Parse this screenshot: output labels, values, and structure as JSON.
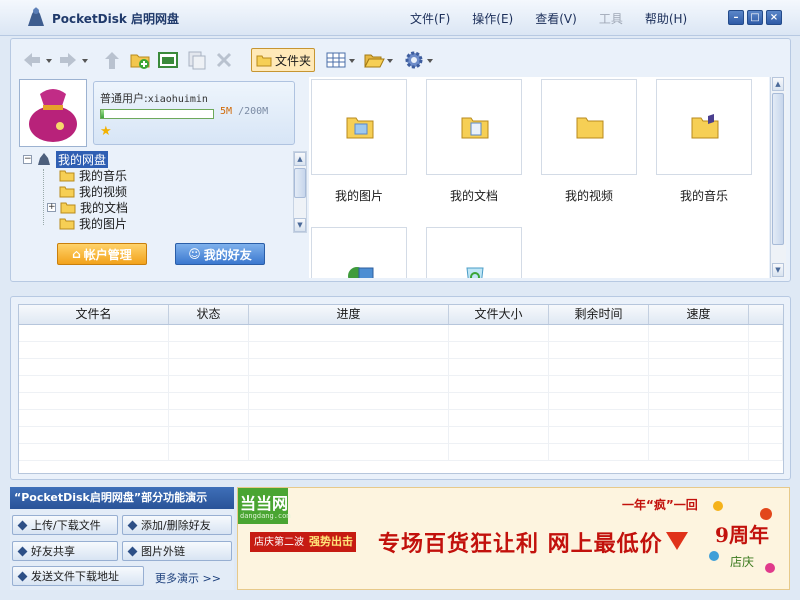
{
  "app": {
    "title": "PocketDisk 启明网盘"
  },
  "menu": [
    {
      "label": "文件(F)",
      "disabled": false
    },
    {
      "label": "操作(E)",
      "disabled": false
    },
    {
      "label": "查看(V)",
      "disabled": false
    },
    {
      "label": "工具",
      "disabled": true
    },
    {
      "label": "帮助(H)",
      "disabled": false
    }
  ],
  "toolbar": {
    "folder_label": "文件夹"
  },
  "user": {
    "label": "普通用户:",
    "name": "xiaohuimin",
    "quota_used": "5M",
    "quota_total": "/200M",
    "quota_fraction": 0.025
  },
  "tree": {
    "root": "我的网盘",
    "children": [
      "我的音乐",
      "我的视频",
      "我的文档",
      "我的图片"
    ]
  },
  "buttons": {
    "account": "帐户管理",
    "friends": "我的好友"
  },
  "folders": [
    "我的图片",
    "我的文档",
    "我的视频",
    "我的音乐"
  ],
  "table": {
    "headers": [
      "文件名",
      "状态",
      "进度",
      "文件大小",
      "剩余时间",
      "速度"
    ]
  },
  "demo": {
    "title": "“PocketDisk启明网盘”部分功能演示",
    "items": [
      "上传/下载文件",
      "添加/删除好友",
      "好友共享",
      "图片外链",
      "发送文件下载地址"
    ],
    "more": "更多演示 >>"
  },
  "ad": {
    "logo": "当当网",
    "logo_sub": "dangdang.com",
    "badge_prefix": "店庆第二波",
    "badge_main": "强势出击",
    "headline": "专场百货狂让利 网上最低价",
    "slogan": "一年“疯”一回",
    "anniv": "9周年",
    "anniv_sub": "店庆"
  },
  "colors": {
    "accent": "#2f5fb3",
    "ad_red": "#c2110c",
    "quota": "#d06b0a"
  }
}
